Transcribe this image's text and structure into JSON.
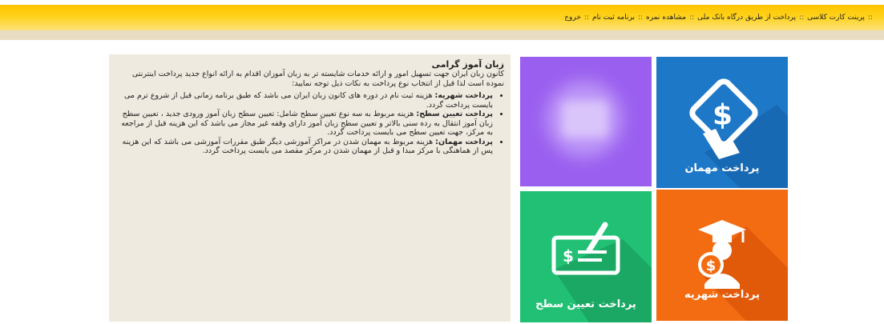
{
  "menu": {
    "items": [
      {
        "label": "پرینت کارت کلاسی",
        "sep": "::"
      },
      {
        "label": "پرداخت از طریق درگاه بانک ملی",
        "sep": "::"
      },
      {
        "label": "مشاهده نمره",
        "sep": "::"
      },
      {
        "label": "برنامه ثبت نام",
        "sep": "::"
      },
      {
        "label": "خروج",
        "sep": "::"
      }
    ]
  },
  "intro": {
    "title": "زبان آموز گرامی",
    "text": "کانون زبان ایران جهت تسهیل امور و ارائه خدمات شایسته تر به زبان آموزان اقدام به ارائه انواع جدید پرداخت اینترنتی نموده است لذا قبل از انتخاب نوع پرداخت به نکات ذیل توجه نمایید:",
    "bullets": [
      {
        "term": "پرداخت شهریه:",
        "text": "هزینه ثبت نام در دوره های کانون زبان ایران می باشد که طبق برنامه زمانی قبل از شروع ترم می بایست پرداخت گردد."
      },
      {
        "term": "پرداخت تعیین سطح:",
        "text": "هزینه مربوط به سه نوع تعیین سطح شامل: تعیین سطح زبان آموز ورودی جدید ، تعیین سطح زبان آموز انتقال به رده سنی بالاتر و تعیین سطح زبان آموز دارای وقفه غیر مجاز می باشد که این هزینه قبل از مراجعه به مرکز، جهت تعیین سطح می بایست پرداخت گردد."
      },
      {
        "term": "پرداخت مهمان:",
        "text": "هزینه مربوط به مهمان شدن در مراکز آموزشی دیگر طبق مقررات آموزشی می باشد که این هزینه پس از هماهنگی با مرکز مبدا و قبل از مهمان شدن در مرکز مقصد می بایست پرداخت گردد."
      }
    ]
  },
  "tiles": {
    "guest": {
      "label": "پرداخت مهمان",
      "icon": "card-dollar-icon",
      "color": "#1e78c8"
    },
    "tuition": {
      "label": "پرداخت شهریه",
      "icon": "graduate-dollar-icon",
      "color": "#f36c12"
    },
    "level": {
      "label": "پرداخت تعیین سطح",
      "icon": "cheque-pen-icon",
      "color": "#21c074"
    },
    "blurred": {
      "icon": "blurred-icon",
      "color": "#9a5fef"
    }
  }
}
